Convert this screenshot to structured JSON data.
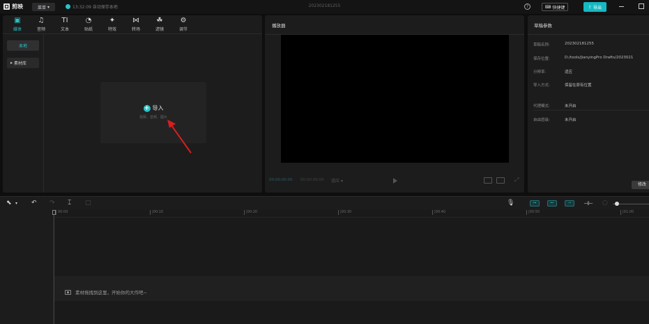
{
  "app": {
    "name": "剪映",
    "menu_label": "菜单",
    "autosave_text": "13:32:09 自动保存本地",
    "project_title": "202302181255",
    "shortcut_label": "快捷键",
    "export_label": "导出",
    "accent_color": "#28c5c8"
  },
  "media_tabs": [
    {
      "label": "媒体",
      "icon": "media-icon",
      "glyph": "▣"
    },
    {
      "label": "音频",
      "icon": "audio-icon",
      "glyph": "♫"
    },
    {
      "label": "文本",
      "icon": "text-icon",
      "glyph": "TI"
    },
    {
      "label": "贴纸",
      "icon": "sticker-icon",
      "glyph": "◔"
    },
    {
      "label": "特效",
      "icon": "effects-icon",
      "glyph": "✦"
    },
    {
      "label": "转场",
      "icon": "transition-icon",
      "glyph": "⋈"
    },
    {
      "label": "滤镜",
      "icon": "filter-icon",
      "glyph": "☘"
    },
    {
      "label": "调节",
      "icon": "adjust-icon",
      "glyph": "⚙"
    }
  ],
  "media_sidebar": {
    "local": "本地",
    "library": "素材库"
  },
  "import": {
    "label": "导入",
    "hint": "视频、音频、图片"
  },
  "player": {
    "title": "播放器",
    "current_time": "00:00:00:00",
    "total_time": "00:00:00:00",
    "ratio": "适应"
  },
  "draft_params": {
    "title": "草稿参数",
    "rows": [
      {
        "label": "草稿名称:",
        "value": "202302181255"
      },
      {
        "label": "保存位置:",
        "value": "D:/tools/JianyingPro Drafts/2023021"
      },
      {
        "label": "分辨率:",
        "value": "适应"
      },
      {
        "label": "导入方式:",
        "value": "保留在原有位置"
      },
      {
        "label": "代理模式:",
        "value": "未开启"
      },
      {
        "label": "自由层级:",
        "value": "未开启"
      }
    ],
    "modify_button": "修改"
  },
  "timeline": {
    "ticks": [
      "00:00",
      "|00:10",
      "|00:20",
      "|00:30",
      "|00:40",
      "|00:50",
      "|01:00"
    ],
    "drop_hint": "素材拖拽到这里，开始你的大作吧~"
  }
}
